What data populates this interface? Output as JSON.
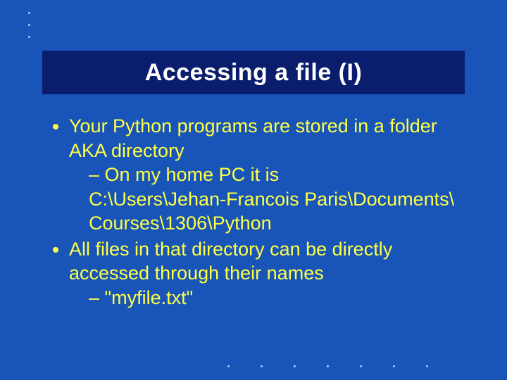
{
  "slide": {
    "title": "Accessing a file (I)",
    "bullet1": "Your Python programs are stored in a folder AKA directory",
    "sub1a": "On my home PC it is",
    "path_line1": "C:\\Users\\Jehan-Francois Paris\\Documents\\ Courses\\1306\\Python",
    "bullet2": "All files in that directory can be directly accessed through their names",
    "sub2a": "\"myfile.txt\""
  }
}
